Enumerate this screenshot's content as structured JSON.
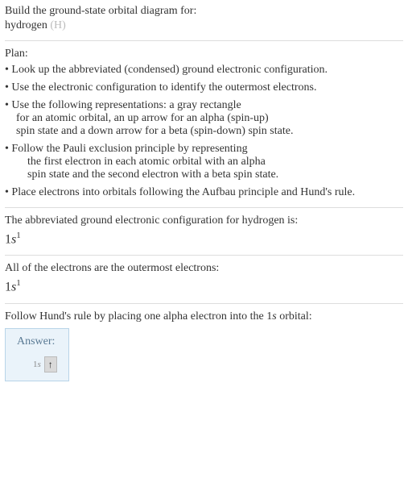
{
  "title": {
    "prompt": "Build the ground-state orbital diagram for:",
    "element_name": "hydrogen",
    "element_symbol": "(H)"
  },
  "plan": {
    "label": "Plan:",
    "items": [
      {
        "lines": [
          "• Look up the abbreviated (condensed) ground electronic configuration."
        ]
      },
      {
        "lines": [
          "• Use the electronic configuration to identify the outermost electrons."
        ]
      },
      {
        "lines": [
          "• Use the following representations: a gray rectangle",
          "for an atomic orbital, an up arrow for an alpha (spin-up)",
          "spin state and a down arrow for a beta (spin-down) spin state."
        ]
      },
      {
        "lines": [
          "• Follow the Pauli exclusion principle by representing",
          "the first electron in each atomic orbital with an alpha",
          "spin state and the second electron with a beta spin state."
        ],
        "indent_after_first": true
      },
      {
        "lines": [
          "• Place electrons into orbitals following the Aufbau principle and Hund's rule."
        ]
      }
    ]
  },
  "section1": {
    "text": "The abbreviated ground electronic configuration for hydrogen is:",
    "config_n": "1",
    "config_l": "s",
    "config_e": "1"
  },
  "section2": {
    "text": "All of the electrons are the outermost electrons:",
    "config_n": "1",
    "config_l": "s",
    "config_e": "1"
  },
  "section3": {
    "text_a": "Follow Hund's rule by placing one alpha electron into the 1",
    "text_orb": "s",
    "text_b": " orbital:"
  },
  "answer": {
    "label": "Answer:",
    "orbital_n": "1",
    "orbital_l": "s",
    "arrow": "↑"
  }
}
